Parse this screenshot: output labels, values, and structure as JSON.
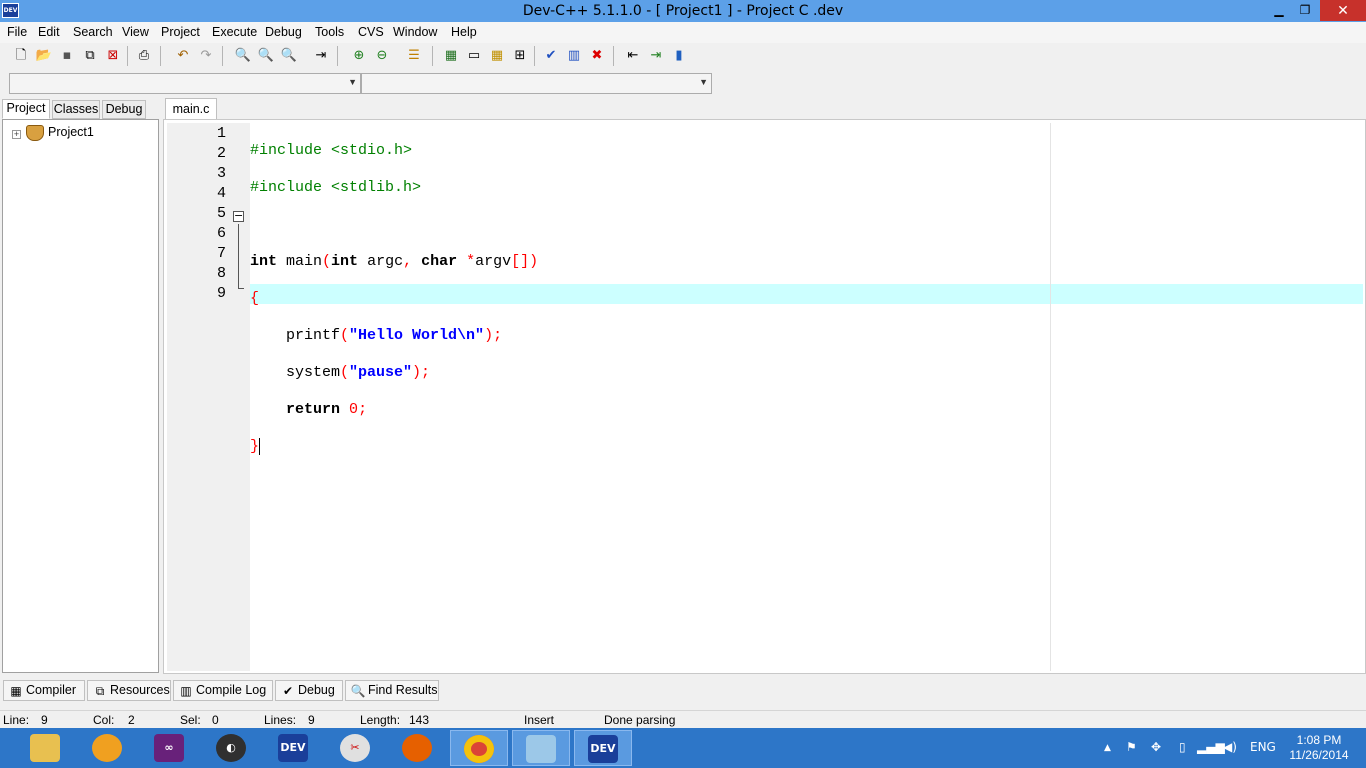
{
  "window": {
    "title": "Dev-C++ 5.1.1.0 - [ Project1 ] - Project C .dev",
    "app_icon_text": "DEV"
  },
  "menu": [
    "File",
    "Edit",
    "Search",
    "View",
    "Project",
    "Execute",
    "Debug",
    "Tools",
    "CVS",
    "Window",
    "Help"
  ],
  "toolbar_icons": [
    "new-file-icon",
    "open-file-icon",
    "save-icon",
    "save-all-icon",
    "close-file-icon",
    "print-icon",
    "undo-icon",
    "redo-icon",
    "find-icon",
    "replace-icon",
    "find-next-icon",
    "goto-line-icon",
    "insert-icon",
    "remove-icon",
    "compile-icon",
    "compile-run-icon",
    "rebuild-icon",
    "run-icon",
    "check-syntax-icon",
    "profile-icon",
    "stop-icon",
    "new-project-icon",
    "add-to-project-icon",
    "project-options-icon"
  ],
  "left_tabs": [
    "Project",
    "Classes",
    "Debug"
  ],
  "project_tree": {
    "root": "Project1"
  },
  "editor": {
    "tab": "main.c",
    "line_numbers": [
      "1",
      "2",
      "3",
      "4",
      "5",
      "6",
      "7",
      "8",
      "9"
    ]
  },
  "bottom_tabs": [
    "Compiler",
    "Resources",
    "Compile Log",
    "Debug",
    "Find Results"
  ],
  "status": {
    "line_label": "Line:",
    "line": "9",
    "col_label": "Col:",
    "col": "2",
    "sel_label": "Sel:",
    "sel": "0",
    "lines_label": "Lines:",
    "lines": "9",
    "length_label": "Length:",
    "length": "143",
    "mode": "Insert",
    "message": "Done parsing"
  },
  "taskbar": {
    "dev_label": "DEV",
    "language": "ENG",
    "time": "1:08 PM",
    "date": "11/26/2014"
  }
}
